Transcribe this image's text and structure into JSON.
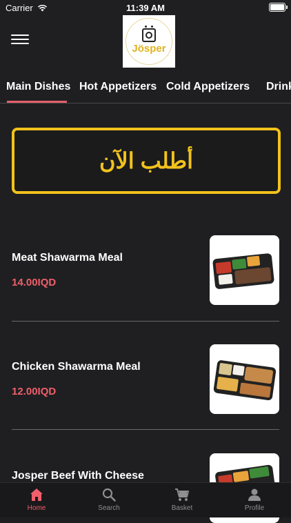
{
  "status_bar": {
    "carrier": "Carrier",
    "time": "11:39 AM"
  },
  "logo": {
    "text": "Jösper"
  },
  "tabs": [
    {
      "label": "Main Dishes",
      "active": true
    },
    {
      "label": "Hot Appetizers",
      "active": false
    },
    {
      "label": "Cold Appetizers",
      "active": false
    },
    {
      "label": "Drink",
      "active": false
    }
  ],
  "order_banner": {
    "text": "أطلب الآن"
  },
  "menu_items": [
    {
      "name": "Meat Shawarma Meal",
      "price": "14.00IQD"
    },
    {
      "name": "Chicken Shawarma Meal",
      "price": "12.00IQD"
    },
    {
      "name": "Josper Beef With Cheese",
      "price": ""
    }
  ],
  "bottom_nav": [
    {
      "label": "Home",
      "icon": "home-icon",
      "active": true
    },
    {
      "label": "Search",
      "icon": "search-icon",
      "active": false
    },
    {
      "label": "Basket",
      "icon": "cart-icon",
      "active": false
    },
    {
      "label": "Profile",
      "icon": "person-icon",
      "active": false
    }
  ],
  "colors": {
    "accent": "#ef5f6b",
    "banner": "#f2c21c",
    "background": "#1f1f21"
  }
}
